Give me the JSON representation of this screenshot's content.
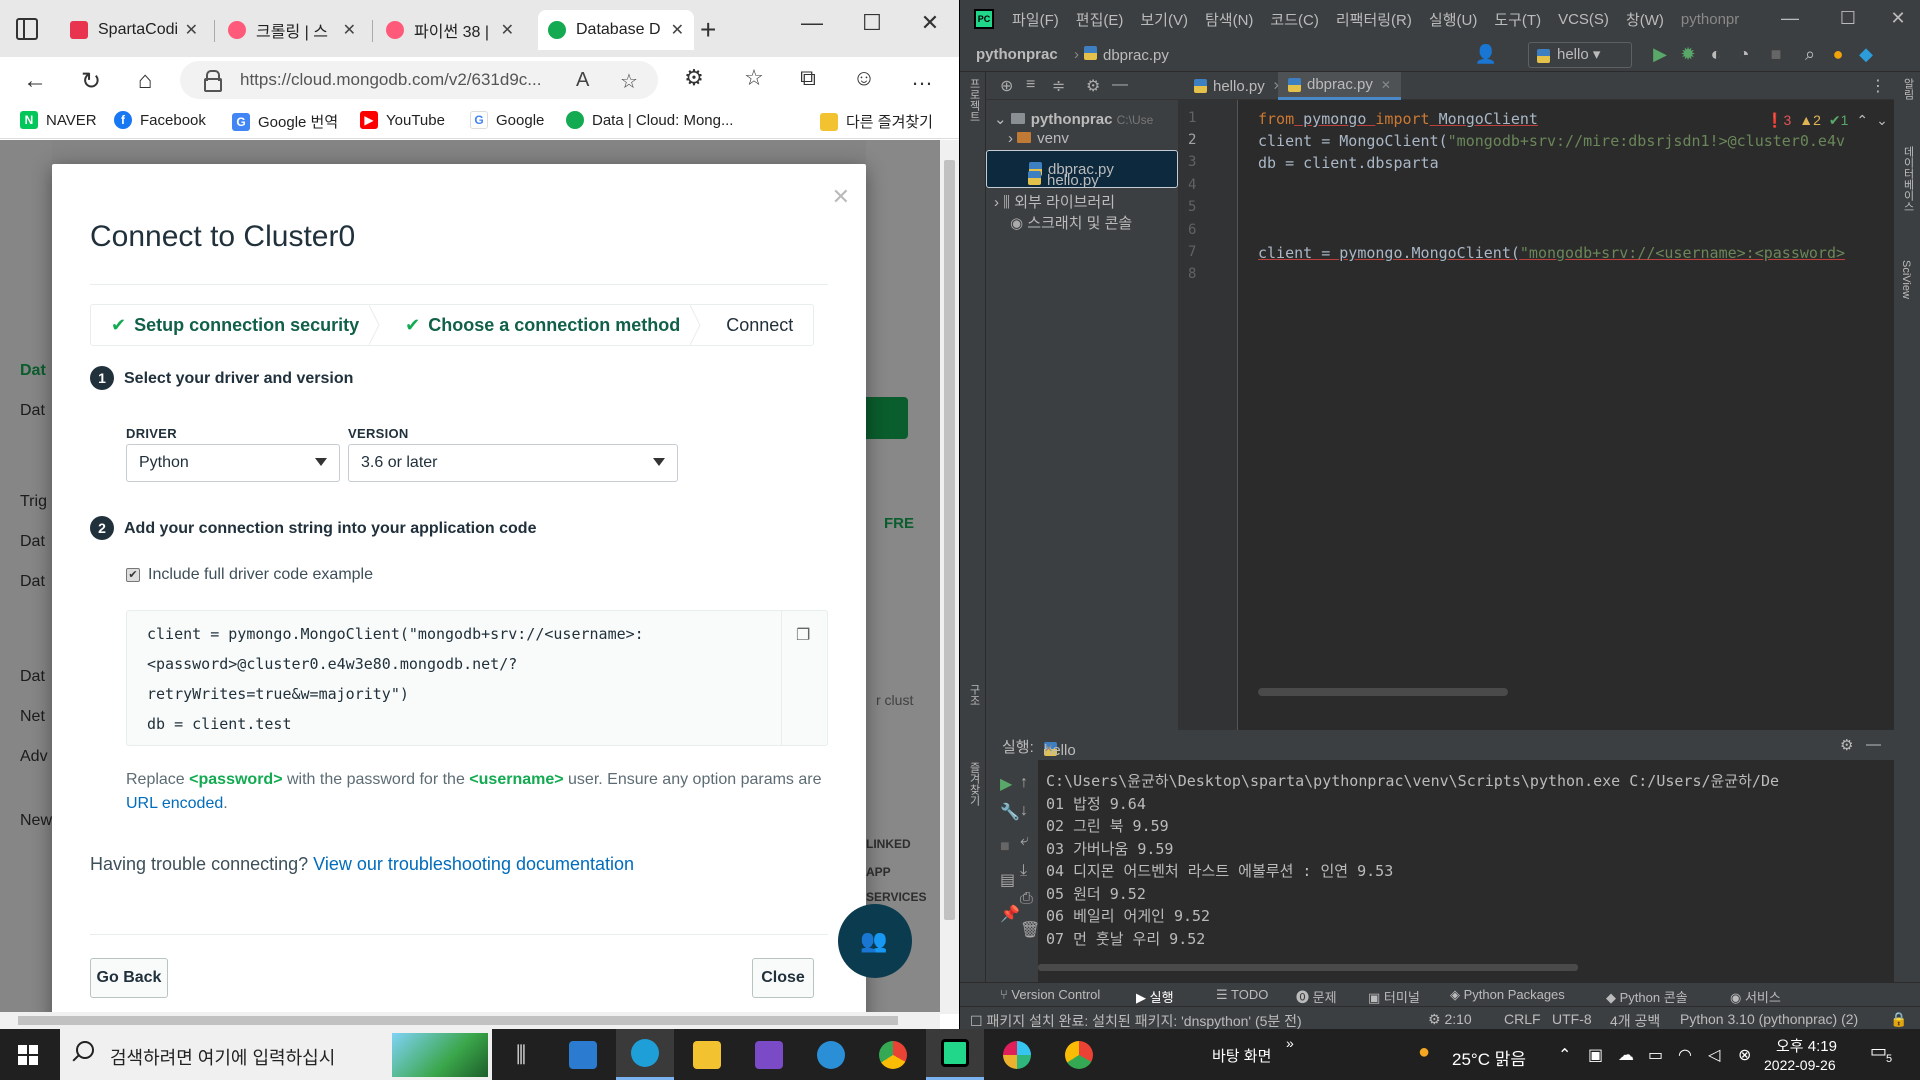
{
  "browser": {
    "tabs": [
      {
        "title": "SpartaCodi",
        "color": "#e8344e",
        "active": false
      },
      {
        "title": "크롤링 | 스",
        "color": "#ff5a7a",
        "active": false
      },
      {
        "title": "파이썬 38 |",
        "color": "#ff5a7a",
        "active": false
      },
      {
        "title": "Database D",
        "color": "#13aa52",
        "active": true
      }
    ],
    "url": "https://cloud.mongodb.com/v2/631d9c...",
    "bookmarks": [
      {
        "label": "NAVER",
        "icon": "N",
        "color": "#03c75a"
      },
      {
        "label": "Facebook",
        "icon": "f",
        "color": "#1877f2"
      },
      {
        "label": "Google 번역",
        "icon": "G",
        "color": "#4285f4"
      },
      {
        "label": "YouTube",
        "icon": "▶",
        "color": "#ff0000"
      },
      {
        "label": "Google",
        "icon": "G",
        "color": "#fbbc05"
      },
      {
        "label": "Data | Cloud: Mong...",
        "icon": "●",
        "color": "#13aa52"
      }
    ],
    "other_favorites": "다른 즐겨찾기",
    "bg_sidebar_fragments": [
      "Dat",
      "Dat",
      "Trig",
      "Dat",
      "Dat",
      "Dat",
      "Net",
      "Adv",
      "New"
    ],
    "bg_fragments": {
      "fre": "FRE",
      "cluster": "r clust",
      "linked": "LINKED",
      "app": "APP",
      "services": "SERVICES"
    }
  },
  "modal": {
    "title": "Connect to Cluster0",
    "steps": [
      {
        "label": "Setup connection security",
        "done": true
      },
      {
        "label": "Choose a connection method",
        "done": true
      },
      {
        "label": "Connect",
        "done": false
      }
    ],
    "section1": {
      "num": "1",
      "title": "Select your driver and version"
    },
    "driver_label": "DRIVER",
    "driver_value": "Python",
    "version_label": "VERSION",
    "version_value": "3.6 or later",
    "section2": {
      "num": "2",
      "title": "Add your connection string into your application code"
    },
    "include_label": "Include full driver code example",
    "include_checked": true,
    "code_lines": [
      "client = pymongo.MongoClient(\"mongodb+srv://<username>:",
      "<password>@cluster0.e4w3e80.mongodb.net/?",
      "retryWrites=true&w=majority\")",
      "db = client.test"
    ],
    "note_pre": "Replace ",
    "note_password": "<password>",
    "note_mid": " with the password for the ",
    "note_username": "<username>",
    "note_post": " user. Ensure any option params are ",
    "note_link": "URL encoded",
    "note_end": ".",
    "trouble_text": "Having trouble connecting? ",
    "trouble_link": "View our troubleshooting documentation",
    "go_back": "Go Back",
    "close": "Close"
  },
  "ide": {
    "menu": [
      "파일(F)",
      "편집(E)",
      "보기(V)",
      "탐색(N)",
      "코드(C)",
      "리팩터링(R)",
      "실행(U)",
      "도구(T)",
      "VCS(S)",
      "창(W)",
      "pythonpr"
    ],
    "breadcrumb_project": "pythonprac",
    "breadcrumb_file": "dbprac.py",
    "run_config": "hello",
    "project_tree": [
      {
        "label": "pythonprac",
        "suffix": "C:\\Use",
        "kind": "folder",
        "indent": 0,
        "selected": false
      },
      {
        "label": "venv",
        "suffix": "",
        "kind": "folder-orange",
        "indent": 1,
        "selected": false
      },
      {
        "label": "dbprac.py",
        "suffix": "",
        "kind": "py",
        "indent": 2,
        "selected": true
      },
      {
        "label": "hello.py",
        "suffix": "",
        "kind": "py",
        "indent": 2,
        "selected": false
      },
      {
        "label": "외부 라이브러리",
        "suffix": "",
        "kind": "lib",
        "indent": 0,
        "selected": false
      },
      {
        "label": "스크래치 및 콘솔",
        "suffix": "",
        "kind": "scratch",
        "indent": 1,
        "selected": false
      }
    ],
    "editor_tabs": [
      {
        "label": "hello.py",
        "active": false
      },
      {
        "label": "dbprac.py",
        "active": true
      }
    ],
    "line_numbers": [
      "1",
      "2",
      "3",
      "4",
      "5",
      "6",
      "7",
      "8"
    ],
    "inspections": {
      "errors": "3",
      "warnings": "2",
      "ok": "1"
    },
    "code": {
      "l1_from": "from",
      "l1_mod": " pymongo ",
      "l1_import": "import",
      "l1_cls": " MongoClient",
      "l2_pre": "client = MongoClient(",
      "l2_str": "\"mongodb+srv://mire:dbsrjsdn1!>@cluster0.e4v",
      "l3": "db = client.dbsparta",
      "l7_pre": "client = pymongo.MongoClient(",
      "l7_str": "\"mongodb+srv://<username>:<password>"
    },
    "run_label": "실행:",
    "run_tab": "hello",
    "console_lines": [
      "C:\\Users\\윤균하\\Desktop\\sparta\\pythonprac\\venv\\Scripts\\python.exe C:/Users/윤균하/De",
      "01 밥정 9.64",
      "02 그린 북 9.59",
      "03 가버나움 9.59",
      "04 디지몬 어드벤처 라스트 에볼루션 : 인연 9.53",
      "05 원더 9.52",
      "06 베일리 어게인 9.52",
      "07 먼 훗날 우리 9.52"
    ],
    "bottom_tools": [
      "Version Control",
      "실행",
      "TODO",
      "문제",
      "터미널",
      "Python Packages",
      "Python 콘솔",
      "서비스"
    ],
    "status": {
      "message": "패키지 설치 완료: 설치된 패키지: 'dnspython' (5분 전)",
      "position": "2:10",
      "line_sep": "CRLF",
      "encoding": "UTF-8",
      "indent": "4개 공백",
      "interpreter": "Python 3.10 (pythonprac) (2)"
    },
    "left_strip": [
      "프로젝트",
      "구조",
      "즐겨찾기"
    ],
    "right_strip": [
      "알림",
      "데이터베이스",
      "SciView"
    ]
  },
  "taskbar": {
    "search_placeholder": "검색하려면 여기에 입력하십시",
    "desktop_label": "바탕 화면",
    "weather": "25°C 맑음",
    "time": "오후 4:19",
    "date": "2022-09-26",
    "notif_count": "5",
    "apps": [
      {
        "name": "task-view",
        "color": "#cccccc"
      },
      {
        "name": "mail",
        "color": "#2b7bd0"
      },
      {
        "name": "edge",
        "color": "#1e9fd8"
      },
      {
        "name": "file-explorer",
        "color": "#f2c230"
      },
      {
        "name": "visual-studio",
        "color": "#7b4bc7"
      },
      {
        "name": "internet-explorer",
        "color": "#2a8fd6"
      },
      {
        "name": "chrome",
        "color": "#e94235"
      },
      {
        "name": "pycharm",
        "color": "#21d789"
      },
      {
        "name": "slack",
        "color": "#e01e5a"
      },
      {
        "name": "chrome-alt",
        "color": "#34a853"
      }
    ]
  }
}
